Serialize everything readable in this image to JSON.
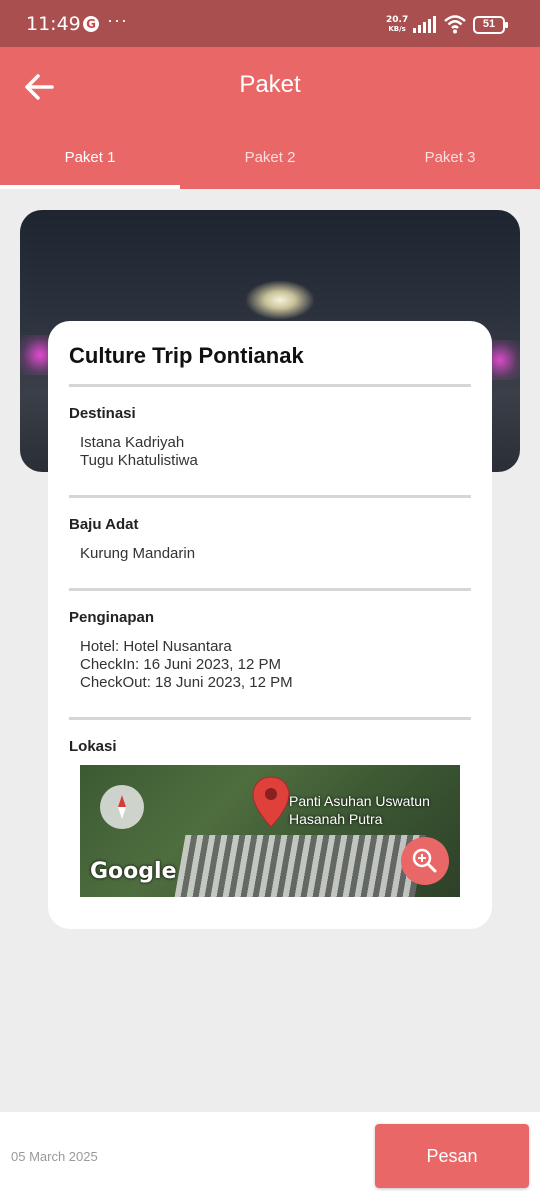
{
  "status_bar": {
    "time": "11:49",
    "google_letter": "G",
    "more_dots": "···",
    "net_speed_value": "20.7",
    "net_speed_unit": "KB/s",
    "battery_level": "51"
  },
  "app_bar": {
    "title": "Paket",
    "back_icon": "arrow-left-icon"
  },
  "tabs": [
    {
      "label": "Paket 1",
      "active": true
    },
    {
      "label": "Paket 2",
      "active": false
    },
    {
      "label": "Paket 3",
      "active": false
    }
  ],
  "card": {
    "title": "Culture Trip Pontianak",
    "destinasi": {
      "label": "Destinasi",
      "items": [
        "Istana Kadriyah",
        "Tugu Khatulistiwa"
      ]
    },
    "baju_adat": {
      "label": "Baju Adat",
      "value": "Kurung Mandarin"
    },
    "penginapan": {
      "label": "Penginapan",
      "hotel": "Hotel: Hotel Nusantara",
      "checkin": "CheckIn: 16 Juni 2023, 12 PM",
      "checkout": "CheckOut: 18 Juni 2023, 12 PM"
    },
    "lokasi": {
      "label": "Lokasi",
      "place_line1": "Panti Asuhan Uswatun",
      "place_line2": "Hasanah Putra",
      "map_logo": "Google"
    }
  },
  "bottom": {
    "date": "05 March 2025",
    "order_label": "Pesan"
  },
  "colors": {
    "accent": "#e96767",
    "status_bar": "#a94f4f",
    "background": "#ededed"
  }
}
